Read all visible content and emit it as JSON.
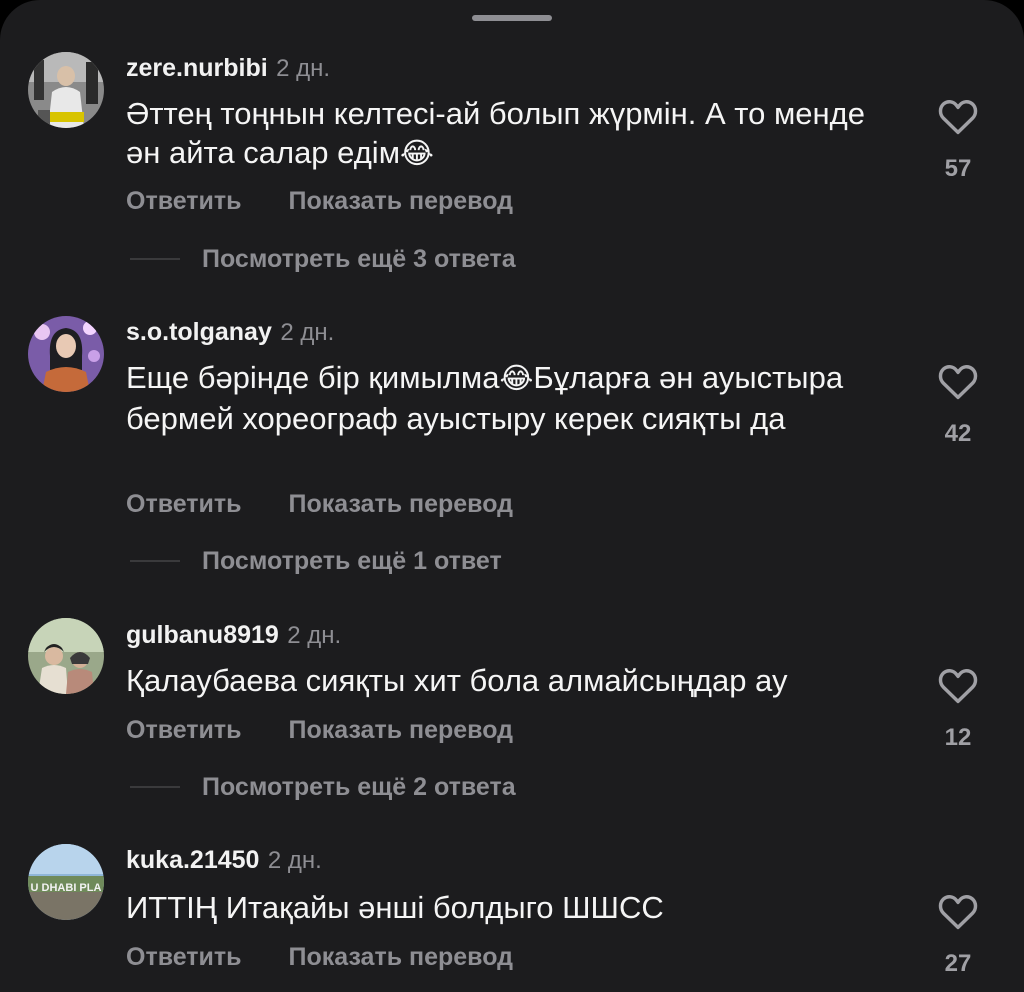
{
  "comments": [
    {
      "username": "zere.nurbibi",
      "time": "2 дн.",
      "text": "Әттең тоңнын келтесі-ай болып жүрмін. А то менде ән айта салар едім",
      "emoji": "😂",
      "reply_label": "Ответить",
      "translate_label": "Показать перевод",
      "more_replies": "Посмотреть ещё 3 ответа",
      "likes": "57"
    },
    {
      "username": "s.o.tolganay",
      "time": "2 дн.",
      "text_before": "Еще бәрінде бір қимылма",
      "emoji": "😂",
      "text_after": "Бұларға ән ауыстыра бермей хореограф ауыстыру керек сияқты да",
      "reply_label": "Ответить",
      "translate_label": "Показать перевод",
      "more_replies": "Посмотреть ещё 1 ответ",
      "likes": "42"
    },
    {
      "username": "gulbanu8919",
      "time": "2 дн.",
      "text": "Қалаубаева сияқты хит бола алмайсыңдар ау",
      "reply_label": "Ответить",
      "translate_label": "Показать перевод",
      "more_replies": "Посмотреть ещё 2 ответа",
      "likes": "12"
    },
    {
      "username": "kuka.21450",
      "time": "2 дн.",
      "text": "ИТТІҢ Итақайы әнші болдыго ШШСС",
      "reply_label": "Ответить",
      "translate_label": "Показать перевод",
      "likes": "27"
    }
  ],
  "avatar_text": {
    "c3": "U DHABI PLA"
  },
  "icons": {
    "like": "heart-outline-icon",
    "drag": "sheet-grabber"
  },
  "colors": {
    "background": "#1c1c1e",
    "primary_text": "#f5f5f5",
    "secondary_text": "#8e8e93"
  }
}
